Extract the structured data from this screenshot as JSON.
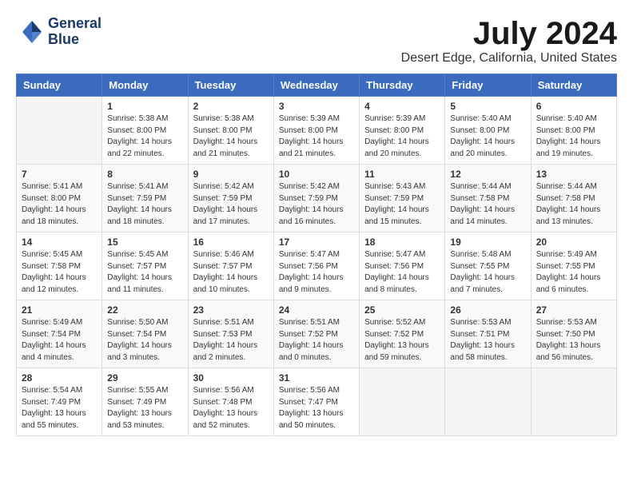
{
  "logo": {
    "line1": "General",
    "line2": "Blue"
  },
  "title": "July 2024",
  "location": "Desert Edge, California, United States",
  "weekdays": [
    "Sunday",
    "Monday",
    "Tuesday",
    "Wednesday",
    "Thursday",
    "Friday",
    "Saturday"
  ],
  "weeks": [
    [
      {
        "day": "",
        "info": ""
      },
      {
        "day": "1",
        "info": "Sunrise: 5:38 AM\nSunset: 8:00 PM\nDaylight: 14 hours\nand 22 minutes."
      },
      {
        "day": "2",
        "info": "Sunrise: 5:38 AM\nSunset: 8:00 PM\nDaylight: 14 hours\nand 21 minutes."
      },
      {
        "day": "3",
        "info": "Sunrise: 5:39 AM\nSunset: 8:00 PM\nDaylight: 14 hours\nand 21 minutes."
      },
      {
        "day": "4",
        "info": "Sunrise: 5:39 AM\nSunset: 8:00 PM\nDaylight: 14 hours\nand 20 minutes."
      },
      {
        "day": "5",
        "info": "Sunrise: 5:40 AM\nSunset: 8:00 PM\nDaylight: 14 hours\nand 20 minutes."
      },
      {
        "day": "6",
        "info": "Sunrise: 5:40 AM\nSunset: 8:00 PM\nDaylight: 14 hours\nand 19 minutes."
      }
    ],
    [
      {
        "day": "7",
        "info": "Sunrise: 5:41 AM\nSunset: 8:00 PM\nDaylight: 14 hours\nand 18 minutes."
      },
      {
        "day": "8",
        "info": "Sunrise: 5:41 AM\nSunset: 7:59 PM\nDaylight: 14 hours\nand 18 minutes."
      },
      {
        "day": "9",
        "info": "Sunrise: 5:42 AM\nSunset: 7:59 PM\nDaylight: 14 hours\nand 17 minutes."
      },
      {
        "day": "10",
        "info": "Sunrise: 5:42 AM\nSunset: 7:59 PM\nDaylight: 14 hours\nand 16 minutes."
      },
      {
        "day": "11",
        "info": "Sunrise: 5:43 AM\nSunset: 7:59 PM\nDaylight: 14 hours\nand 15 minutes."
      },
      {
        "day": "12",
        "info": "Sunrise: 5:44 AM\nSunset: 7:58 PM\nDaylight: 14 hours\nand 14 minutes."
      },
      {
        "day": "13",
        "info": "Sunrise: 5:44 AM\nSunset: 7:58 PM\nDaylight: 14 hours\nand 13 minutes."
      }
    ],
    [
      {
        "day": "14",
        "info": "Sunrise: 5:45 AM\nSunset: 7:58 PM\nDaylight: 14 hours\nand 12 minutes."
      },
      {
        "day": "15",
        "info": "Sunrise: 5:45 AM\nSunset: 7:57 PM\nDaylight: 14 hours\nand 11 minutes."
      },
      {
        "day": "16",
        "info": "Sunrise: 5:46 AM\nSunset: 7:57 PM\nDaylight: 14 hours\nand 10 minutes."
      },
      {
        "day": "17",
        "info": "Sunrise: 5:47 AM\nSunset: 7:56 PM\nDaylight: 14 hours\nand 9 minutes."
      },
      {
        "day": "18",
        "info": "Sunrise: 5:47 AM\nSunset: 7:56 PM\nDaylight: 14 hours\nand 8 minutes."
      },
      {
        "day": "19",
        "info": "Sunrise: 5:48 AM\nSunset: 7:55 PM\nDaylight: 14 hours\nand 7 minutes."
      },
      {
        "day": "20",
        "info": "Sunrise: 5:49 AM\nSunset: 7:55 PM\nDaylight: 14 hours\nand 6 minutes."
      }
    ],
    [
      {
        "day": "21",
        "info": "Sunrise: 5:49 AM\nSunset: 7:54 PM\nDaylight: 14 hours\nand 4 minutes."
      },
      {
        "day": "22",
        "info": "Sunrise: 5:50 AM\nSunset: 7:54 PM\nDaylight: 14 hours\nand 3 minutes."
      },
      {
        "day": "23",
        "info": "Sunrise: 5:51 AM\nSunset: 7:53 PM\nDaylight: 14 hours\nand 2 minutes."
      },
      {
        "day": "24",
        "info": "Sunrise: 5:51 AM\nSunset: 7:52 PM\nDaylight: 14 hours\nand 0 minutes."
      },
      {
        "day": "25",
        "info": "Sunrise: 5:52 AM\nSunset: 7:52 PM\nDaylight: 13 hours\nand 59 minutes."
      },
      {
        "day": "26",
        "info": "Sunrise: 5:53 AM\nSunset: 7:51 PM\nDaylight: 13 hours\nand 58 minutes."
      },
      {
        "day": "27",
        "info": "Sunrise: 5:53 AM\nSunset: 7:50 PM\nDaylight: 13 hours\nand 56 minutes."
      }
    ],
    [
      {
        "day": "28",
        "info": "Sunrise: 5:54 AM\nSunset: 7:49 PM\nDaylight: 13 hours\nand 55 minutes."
      },
      {
        "day": "29",
        "info": "Sunrise: 5:55 AM\nSunset: 7:49 PM\nDaylight: 13 hours\nand 53 minutes."
      },
      {
        "day": "30",
        "info": "Sunrise: 5:56 AM\nSunset: 7:48 PM\nDaylight: 13 hours\nand 52 minutes."
      },
      {
        "day": "31",
        "info": "Sunrise: 5:56 AM\nSunset: 7:47 PM\nDaylight: 13 hours\nand 50 minutes."
      },
      {
        "day": "",
        "info": ""
      },
      {
        "day": "",
        "info": ""
      },
      {
        "day": "",
        "info": ""
      }
    ]
  ]
}
